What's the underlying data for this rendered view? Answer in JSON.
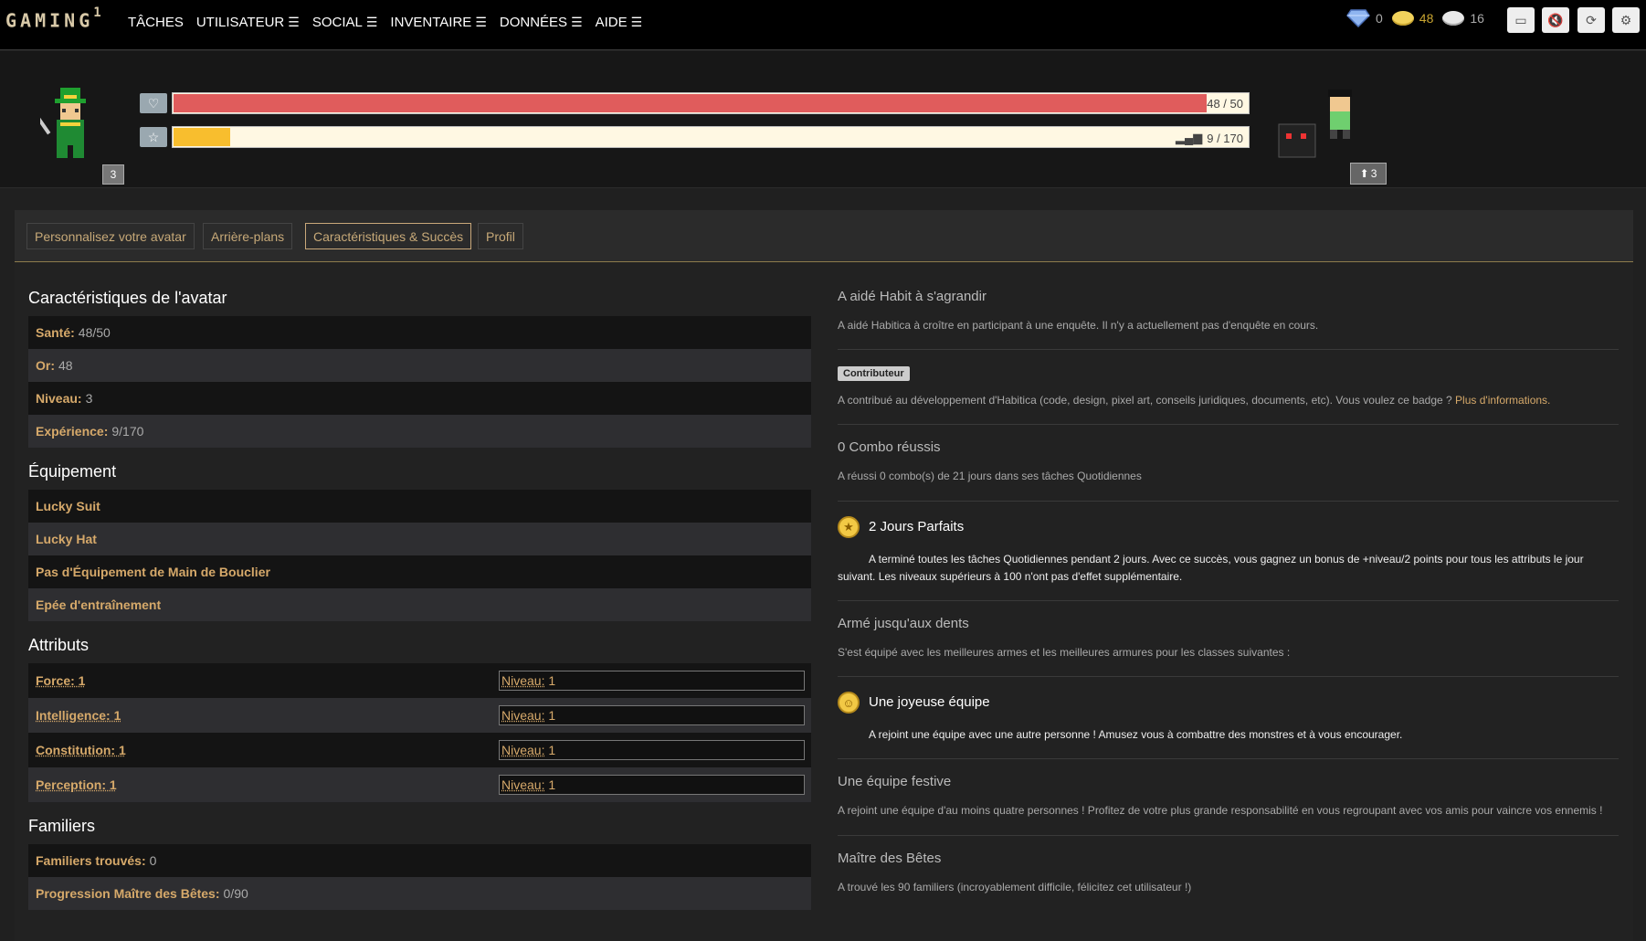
{
  "logo": {
    "text": "GAMING",
    "sup": "1"
  },
  "nav": [
    "TÂCHES",
    "UTILISATEUR",
    "SOCIAL",
    "INVENTAIRE",
    "DONNÉES",
    "AIDE"
  ],
  "nav_menu_flags": [
    false,
    true,
    true,
    true,
    true,
    true
  ],
  "currencies": {
    "gems": "0",
    "gold": "48",
    "hourglass": "16"
  },
  "toolbar_icons": [
    "chat-icon",
    "mute-icon",
    "sync-icon",
    "settings-icon"
  ],
  "hero": {
    "level": "3",
    "health": {
      "current": 48,
      "max": 50,
      "text": "48 / 50",
      "color": "#e05c5c"
    },
    "experience": {
      "current": 9,
      "max": 170,
      "text": "9 / 170",
      "color": "#f8be2e"
    },
    "pet_badge": "3"
  },
  "tabs": [
    "Personnalisez votre avatar",
    "Arrière-plans",
    "Caractéristiques & Succès",
    "Profil"
  ],
  "active_tab": 2,
  "stats": {
    "title": "Caractéristiques de l'avatar",
    "rows": [
      {
        "label": "Santé:",
        "value": "48/50"
      },
      {
        "label": "Or:",
        "value": "48"
      },
      {
        "label": "Niveau:",
        "value": "3"
      },
      {
        "label": "Expérience:",
        "value": "9/170"
      }
    ]
  },
  "equipment": {
    "title": "Équipement",
    "items": [
      "Lucky Suit",
      "Lucky Hat",
      "Pas d'Équipement de Main de Bouclier",
      "Epée d'entraînement"
    ]
  },
  "attributes": {
    "title": "Attributs",
    "rows": [
      {
        "name": "Force: 1",
        "level_label": "Niveau:",
        "level_value": "1"
      },
      {
        "name": "Intelligence: 1",
        "level_label": "Niveau:",
        "level_value": "1"
      },
      {
        "name": "Constitution: 1",
        "level_label": "Niveau:",
        "level_value": "1"
      },
      {
        "name": "Perception: 1",
        "level_label": "Niveau:",
        "level_value": "1"
      }
    ]
  },
  "pets": {
    "title": "Familiers",
    "rows": [
      {
        "label": "Familiers trouvés:",
        "value": "0"
      },
      {
        "label": "Progression Maître des Bêtes:",
        "value": "0/90"
      }
    ]
  },
  "achievements": [
    {
      "title": "A aidé Habit à s'agrandir",
      "desc": "A aidé Habitica à croître en participant à une enquête. Il n'y a actuellement pas d'enquête en cours."
    },
    {
      "badge": "Contributeur",
      "desc": "A contribué au développement d'Habitica (code, design, pixel art, conseils juridiques, documents, etc). Vous voulez ce badge ?",
      "link": "Plus d'informations."
    },
    {
      "title": "0 Combo réussis",
      "desc": "A réussi 0 combo(s) de 21 jours dans ses tâches Quotidiennes"
    },
    {
      "title": "2 Jours Parfaits",
      "desc": "A terminé toutes les tâches Quotidiennes pendant 2 jours. Avec ce succès, vous gagnez un bonus de +niveau/2 points pour tous les attributs le jour suivant. Les niveaux supérieurs à 100 n'ont pas d'effet supplémentaire.",
      "icon": "star-medal-icon"
    },
    {
      "title": "Armé jusqu'aux dents",
      "desc": "S'est équipé avec les meilleures armes et les meilleures armures pour les classes suivantes :"
    },
    {
      "title": "Une joyeuse équipe",
      "desc": "A rejoint une équipe avec une autre personne ! Amusez vous à combattre des monstres et à vous encourager.",
      "icon": "party-medal-icon"
    },
    {
      "title": "Une équipe festive",
      "desc": "A rejoint une équipe d'au moins quatre personnes ! Profitez de votre plus grande responsabilité en vous regroupant avec vos amis pour vaincre vos ennemis !"
    },
    {
      "title": "Maître des Bêtes",
      "desc": "A trouvé les 90 familiers (incroyablement difficile, félicitez cet utilisateur !)"
    }
  ]
}
